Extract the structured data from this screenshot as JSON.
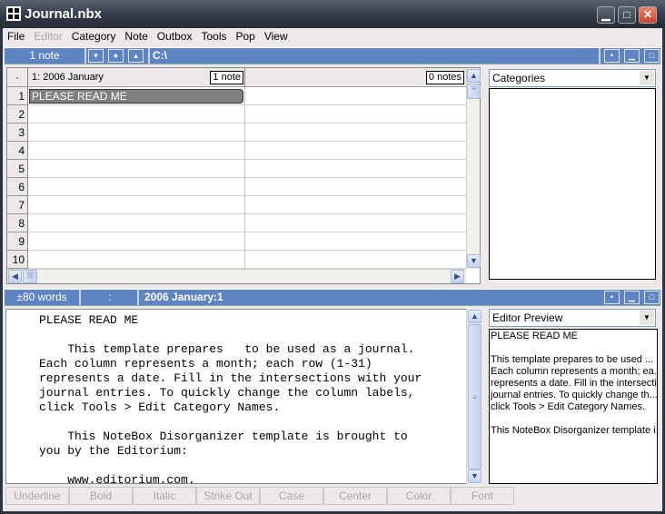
{
  "window": {
    "title": "Journal.nbx"
  },
  "menu": [
    "File",
    "Editor",
    "Category",
    "Note",
    "Outbox",
    "Tools",
    "Pop",
    "View"
  ],
  "toolbar": {
    "note_count": "1 note",
    "path": "C:\\"
  },
  "grid": {
    "corner": "·",
    "columns": [
      {
        "label": "1: 2006 January",
        "badge": "1 note"
      },
      {
        "label": "",
        "badge": "0 notes"
      }
    ],
    "rows": [
      {
        "num": "1",
        "cells": [
          "PLEASE READ ME",
          ""
        ]
      },
      {
        "num": "2",
        "cells": [
          "",
          ""
        ]
      },
      {
        "num": "3",
        "cells": [
          "",
          ""
        ]
      },
      {
        "num": "4",
        "cells": [
          "",
          ""
        ]
      },
      {
        "num": "5",
        "cells": [
          "",
          ""
        ]
      },
      {
        "num": "6",
        "cells": [
          "",
          ""
        ]
      },
      {
        "num": "7",
        "cells": [
          "",
          ""
        ]
      },
      {
        "num": "8",
        "cells": [
          "",
          ""
        ]
      },
      {
        "num": "9",
        "cells": [
          "",
          ""
        ]
      },
      {
        "num": "10",
        "cells": [
          "",
          ""
        ]
      }
    ]
  },
  "categories": {
    "selected": "Categories"
  },
  "status": {
    "words": "±80 words",
    "position": ":",
    "note_title": "2006 January:1"
  },
  "editor": {
    "text": "PLEASE READ ME\n\n    This template prepares   to be used as a journal.\nEach column represents a month; each row (1-31)\nrepresents a date. Fill in the intersections with your\njournal entries. To quickly change the column labels,\nclick Tools > Edit Category Names.\n\n    This NoteBox Disorganizer template is brought to\nyou by the Editorium:\n\n    www.editorium.com."
  },
  "preview": {
    "selected": "Editor Preview",
    "lines": [
      "PLEASE READ ME",
      "",
      "This template prepares   to be used ...",
      "Each column represents a month; ea...",
      "represents a date. Fill in the intersecti...",
      "journal entries. To quickly change th...",
      "click Tools > Edit Category Names.",
      "",
      "This NoteBox Disorganizer template i..."
    ]
  },
  "format_buttons": [
    "Underline",
    "Bold",
    "Italic",
    "Strike Out",
    "Case",
    "Center",
    "Color",
    "Font"
  ]
}
